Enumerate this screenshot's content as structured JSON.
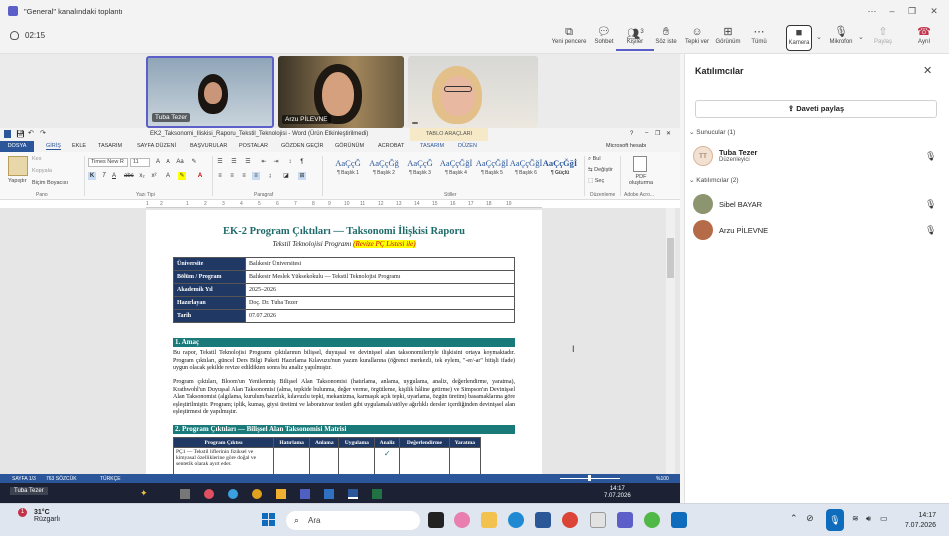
{
  "window": {
    "title": "\"General\" kanalındaki toplantı"
  },
  "toolbar": {
    "timer": "02:15",
    "buttons": [
      {
        "label": "Yeni pencere",
        "icon": "new-window-icon"
      },
      {
        "label": "Sohbet",
        "icon": "chat-icon"
      },
      {
        "label": "Kişiler",
        "icon": "people-icon",
        "badge": "3"
      },
      {
        "label": "Söz iste",
        "icon": "raise-hand-icon"
      },
      {
        "label": "Tepki ver",
        "icon": "react-icon"
      },
      {
        "label": "Görünüm",
        "icon": "view-icon"
      },
      {
        "label": "Tümü",
        "icon": "more-icon"
      },
      {
        "label": "Kamera",
        "icon": "camera-icon"
      },
      {
        "label": "Mikrofon",
        "icon": "mic-icon"
      },
      {
        "label": "Paylaş",
        "icon": "share-icon"
      },
      {
        "label": "Ayrıl",
        "icon": "leave-icon"
      }
    ]
  },
  "videos": [
    {
      "name": "Tuba Tezer"
    },
    {
      "name": "Arzu PİLEVNE"
    },
    {
      "name": ""
    }
  ],
  "word": {
    "title": "EK2_Taksonomi_Iliskisi_Raporu_Tekstil_Teknolojisi - Word (Ürün Etkinleştirilmedi)",
    "context_tab": "TABLO ARAÇLARI",
    "account": "Microsoft hesabı",
    "tabs": [
      "DOSYA",
      "GİRİŞ",
      "EKLE",
      "TASARIM",
      "SAYFA DÜZENİ",
      "BAŞVURULAR",
      "POSTALAR",
      "GÖZDEN GEÇİR",
      "GÖRÜNÜM",
      "ACROBAT",
      "TASARIM",
      "DÜZEN"
    ],
    "ribbon": {
      "paste": "Yapıştır",
      "cut": "Kes",
      "copy": "Kopyala",
      "format_painter": "Biçim Boyacısı",
      "font_name": "Times New R",
      "font_size": "11",
      "find": "Bul",
      "replace": "Değiştir",
      "select": "Seç",
      "pdf": "PDF oluşturma",
      "groups": [
        "Pano",
        "Yazı Tipi",
        "Paragraf",
        "Stiller",
        "Düzenleme",
        "Adobe Acro..."
      ],
      "styles": [
        {
          "preview": "AaÇçĞ",
          "name": "¶ Başlık 1"
        },
        {
          "preview": "AaÇçĞğ",
          "name": "¶ Başlık 2"
        },
        {
          "preview": "AaÇçĞ",
          "name": "¶ Başlık 3"
        },
        {
          "preview": "AaÇçĞğİ",
          "name": "¶ Başlık 4"
        },
        {
          "preview": "AaÇçĞğİ",
          "name": "¶ Başlık 5"
        },
        {
          "preview": "AaÇçĞğİ",
          "name": "¶ Başlık 6"
        },
        {
          "preview": "AaÇçĞğİ",
          "name": "¶ Güçlü"
        }
      ]
    },
    "ruler": [
      "1",
      "2",
      "1",
      "2",
      "3",
      "4",
      "5",
      "6",
      "7",
      "8",
      "9",
      "10",
      "11",
      "12",
      "13",
      "14",
      "15",
      "16",
      "17",
      "18",
      "19"
    ],
    "document": {
      "title": "EK-2 Program Çıktıları — Taksonomi İlişkisi Raporu",
      "subtitle_plain": "Tekstil Teknolojisi Programı ",
      "subtitle_highlight": "(Revize PÇ Listesi ile)",
      "info": [
        {
          "key": "Üniversite",
          "value": "Balıkesir Üniversitesi"
        },
        {
          "key": "Bölüm / Program",
          "value": "Balıkesir Meslek Yüksekokulu — Tekstil Teknolojisi Programı"
        },
        {
          "key": "Akademik Yıl",
          "value": "2025–2026"
        },
        {
          "key": "Hazırlayan",
          "value": "Doç. Dr. Tuba Tezer"
        },
        {
          "key": "Tarih",
          "value": "07.07.2026"
        }
      ],
      "section1": "1. Amaç",
      "para1": "Bu rapor, Tekstil Teknolojisi Programı çıktılarının bilişsel, duyuşsal ve devinişsel alan taksonomileriyle ilişkisini ortaya koymaktadır. Program çıktıları, güncel Ders Bilgi Paketi Hazırlama Kılavuzu'nun yazım kurallarına (öğrenci merkezli, tek eylem, \"-er/-ar\" bitişli ifade) uygun olacak şekilde revize edildikten sonra bu analiz yapılmıştır.",
      "para2": "Program çıktıları, Bloom'un Yenilenmiş Bilişsel Alan Taksonomisi (hatırlama, anlama, uygulama, analiz, değerlendirme, yaratma), Krathwohl'un Duyuşsal Alan Taksonomisi (alma, tepkide bulunma, değer verme, örgütleme, kişilik hâline getirme) ve Simpson'ın Devinişsel Alan Taksonomisi (algılama, kurulum/hazırlık, kılavuzlu tepki, mekanizma, karmaşık açık tepki, uyarlama, özgün üretim) basamaklarına göre eşleştirilmiştir. Program; iplik, kumaş, giysi üretimi ve laboratuvar testleri gibi uygulamalı/atölye ağırlıklı dersler içerdiğinden devinişsel alan eşleştirmesi de yapılmıştır.",
      "section2": "2. Program Çıktıları — Bilişsel Alan Taksonomisi Matrisi",
      "matrix_headers": [
        "Program Çıktısı",
        "Hatırlama",
        "Anlama",
        "Uygulama",
        "Analiz",
        "Değerlendirme",
        "Yaratma"
      ],
      "matrix_row1": "PÇ1 — Tekstil liflerinin fiziksel ve kimyasal özelliklerine göre doğal ve sentetik olarak ayırt eder.",
      "matrix_check": "✓"
    },
    "status": {
      "page": "SAYFA 1/3",
      "words": "763 SÖZCÜK",
      "lang": "TÜRKÇE",
      "zoom": "%100"
    },
    "inner_clock": {
      "time": "14:17",
      "date": "7.07.2026"
    },
    "inner_name": "Tuba Tezer"
  },
  "panel": {
    "title": "Katılımcılar",
    "invite": "Daveti paylaş",
    "presenters_label": "Sunucular (1)",
    "attendees_label": "Katılımcılar (2)",
    "presenters": [
      {
        "initials": "TT",
        "name": "Tuba Tezer",
        "role": "Düzenleyici"
      }
    ],
    "attendees": [
      {
        "name": "Sibel BAYAR"
      },
      {
        "name": "Arzu PİLEVNE"
      }
    ]
  },
  "taskbar": {
    "badge": "1",
    "temp": "31°C",
    "weather": "Rüzgarlı",
    "search": "Ara",
    "time": "14:17",
    "date": "7.07.2026"
  },
  "colors": {
    "teams_accent": "#5b5fc7",
    "word_blue": "#2b579a",
    "section_teal": "#1a7a7a",
    "table_header": "#1f3864",
    "leave_red": "#c4314b"
  }
}
